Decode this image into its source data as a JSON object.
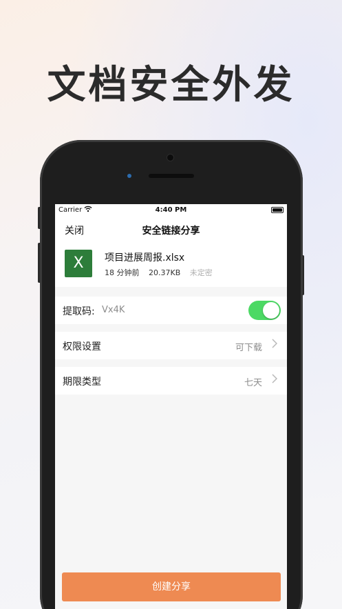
{
  "headline": "文档安全外发",
  "status_bar": {
    "carrier": "Carrier",
    "time": "4:40 PM"
  },
  "nav": {
    "close_label": "关闭",
    "title": "安全链接分享"
  },
  "file": {
    "icon_letter": "X",
    "name": "项目进展周报.xlsx",
    "modified": "18 分钟前",
    "size": "20.37KB",
    "classification": "未定密"
  },
  "extract_code": {
    "label": "提取码:",
    "value": "Vx4K",
    "enabled": true
  },
  "permission": {
    "label": "权限设置",
    "value": "可下载"
  },
  "expiry": {
    "label": "期限类型",
    "value": "七天"
  },
  "create_button_label": "创建分享",
  "colors": {
    "accent": "#ee8a52",
    "toggle_on": "#4cd964",
    "excel_green": "#2d7d3a"
  }
}
